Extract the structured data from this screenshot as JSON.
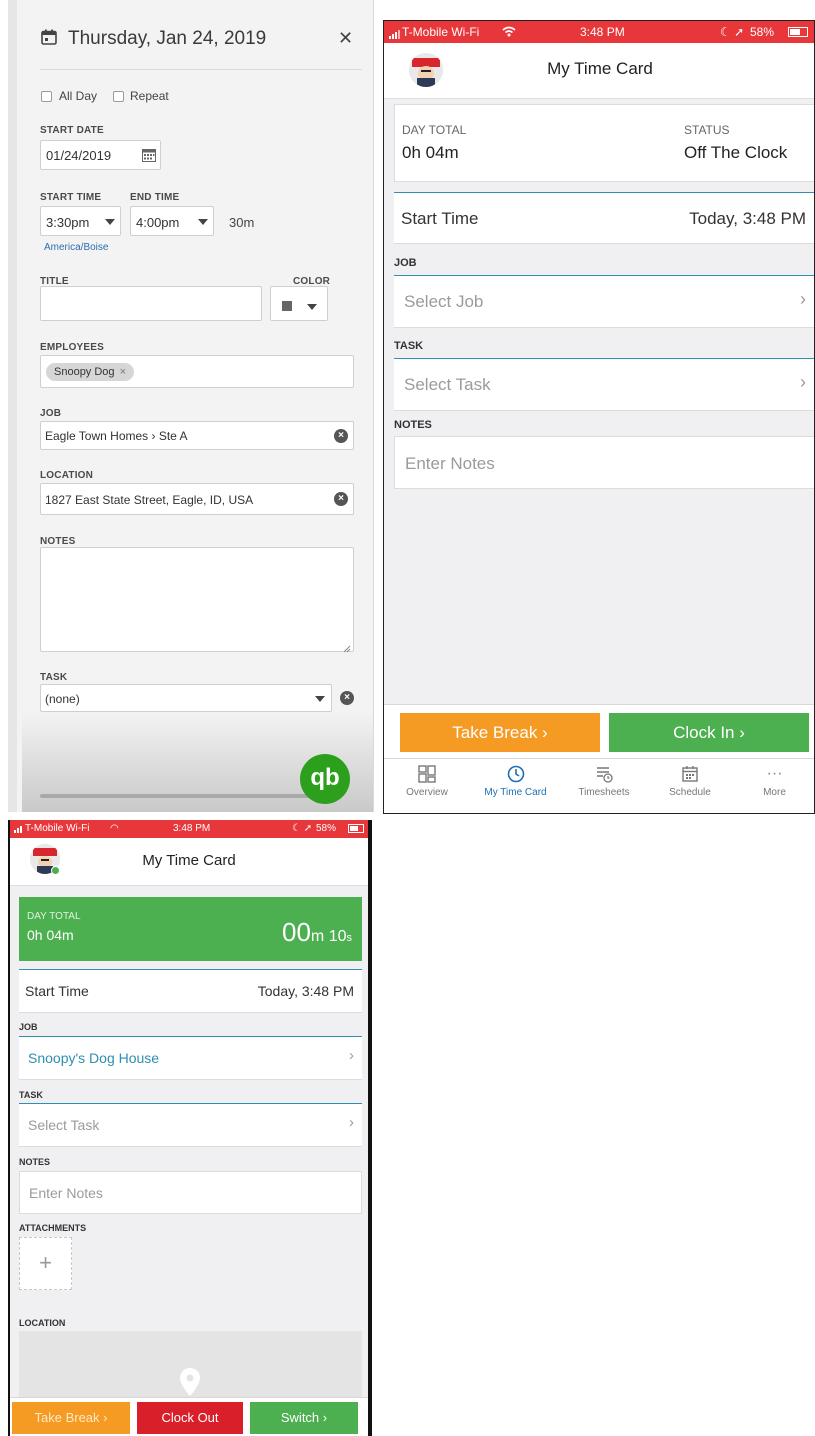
{
  "scheduler": {
    "header_date": "Thursday, Jan 24, 2019",
    "close_glyph": "✕",
    "all_day_label": "All Day",
    "repeat_label": "Repeat",
    "start_date_label": "START DATE",
    "start_date_value": "01/24/2019",
    "start_time_label": "START TIME",
    "end_time_label": "END TIME",
    "start_time_value": "3:30pm",
    "end_time_value": "4:00pm",
    "duration": "30m",
    "timezone": "America/Boise",
    "title_label": "TITLE",
    "title_value": "",
    "color_label": "COLOR",
    "employees_label": "EMPLOYEES",
    "employee_chip": "Snoopy Dog",
    "chip_remove": "×",
    "job_label": "JOB",
    "job_value": "Eagle Town Homes › Ste A",
    "location_label": "LOCATION",
    "location_value": "1827 East State Street, Eagle, ID, USA",
    "notes_label": "NOTES",
    "notes_value": "",
    "task_label": "TASK",
    "task_value": "(none)",
    "clear_glyph": "×",
    "logo_text": "qb"
  },
  "timecard_off": {
    "status_bar": {
      "carrier": "T-Mobile Wi-Fi",
      "time": "3:48 PM",
      "battery": "58%"
    },
    "title": "My Time Card",
    "day_total_label": "DAY TOTAL",
    "day_total_value": "0h 04m",
    "status_label": "STATUS",
    "status_value": "Off The Clock",
    "start_time_label": "Start Time",
    "start_time_value": "Today, 3:48 PM",
    "job_label": "JOB",
    "job_placeholder": "Select Job",
    "task_label": "TASK",
    "task_placeholder": "Select Task",
    "notes_label": "NOTES",
    "notes_placeholder": "Enter Notes",
    "take_break": "Take Break ›",
    "clock_in": "Clock In ›",
    "tabs": [
      "Overview",
      "My Time Card",
      "Timesheets",
      "Schedule",
      "More"
    ],
    "more_glyph": "···",
    "chevron": "›"
  },
  "timecard_on": {
    "status_bar": {
      "carrier": "T-Mobile Wi-Fi",
      "time": "3:48 PM",
      "battery": "58%"
    },
    "title": "My Time Card",
    "day_total_label": "DAY TOTAL",
    "day_total_value": "0h 04m",
    "timer_minutes": "00",
    "timer_minutes_unit": "m",
    "timer_seconds": "10",
    "timer_seconds_unit": "s",
    "start_time_label": "Start Time",
    "start_time_value": "Today, 3:48 PM",
    "job_label": "JOB",
    "job_value": "Snoopy's Dog House",
    "task_label": "TASK",
    "task_placeholder": "Select Task",
    "notes_label": "NOTES",
    "notes_placeholder": "Enter Notes",
    "attachments_label": "ATTACHMENTS",
    "attach_plus": "+",
    "location_label": "LOCATION",
    "take_break": "Take Break ›",
    "clock_out": "Clock Out",
    "switch": "Switch ›",
    "chevron": "›"
  },
  "colors": {
    "status_red": "#e8373b",
    "accent_blue": "#2e8fb0",
    "clocked_green": "#4caf50",
    "break_orange": "#f59a23",
    "clockout_red": "#d81f2a",
    "qb_green": "#2ca01c"
  }
}
